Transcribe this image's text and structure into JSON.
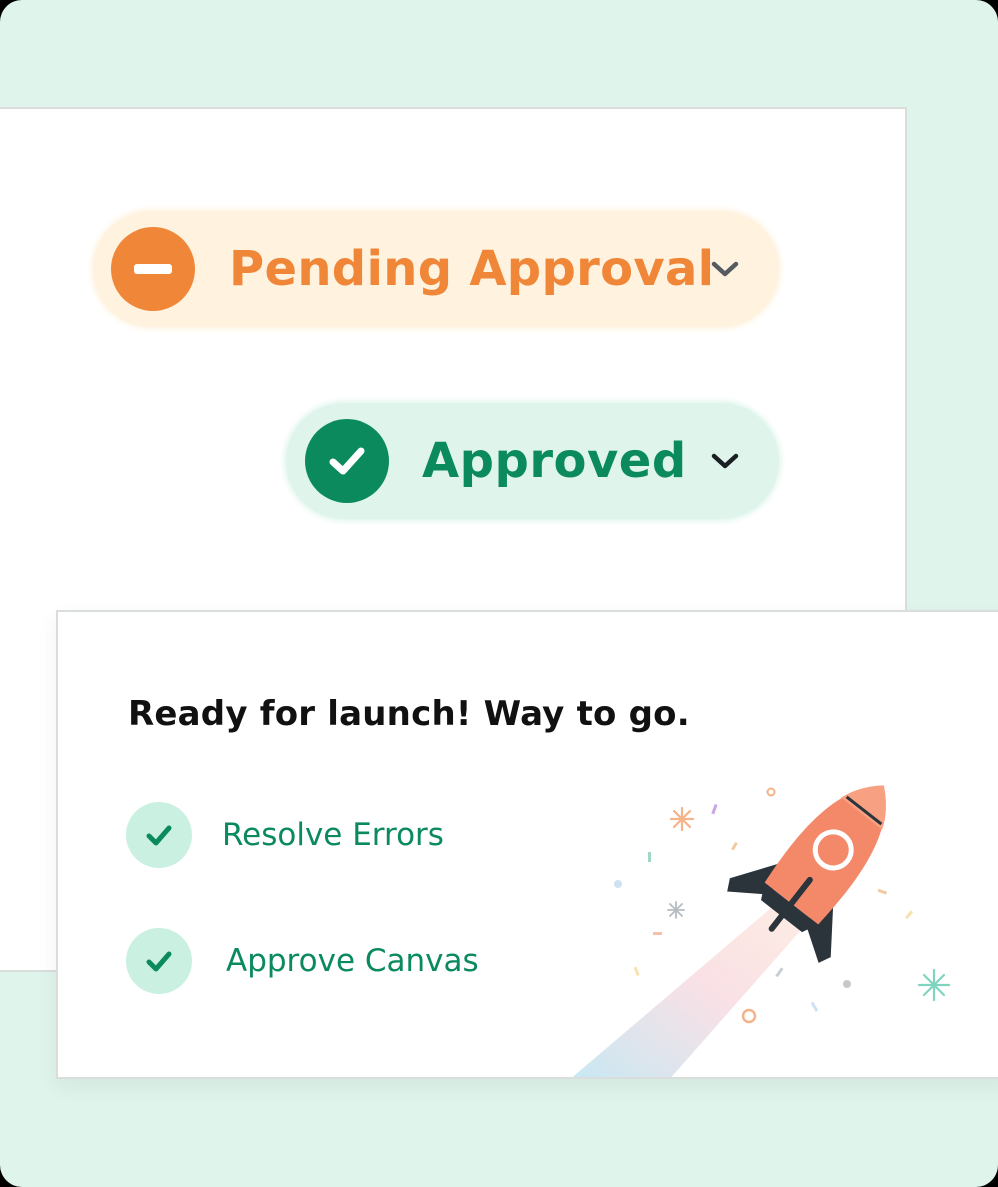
{
  "status_pills": {
    "pending": {
      "label": "Pending Approval",
      "icon": "minus-circle-icon",
      "color": "#f08638",
      "background": "#fff3e0"
    },
    "approved": {
      "label": "Approved",
      "icon": "check-circle-icon",
      "color": "#0b8a5e",
      "background": "#dff5ec"
    }
  },
  "launch_card": {
    "title": "Ready for launch! Way to go.",
    "checklist": [
      {
        "label": "Resolve Errors",
        "icon": "check-icon",
        "done": true
      },
      {
        "label": "Approve Canvas",
        "icon": "check-icon",
        "done": true
      }
    ],
    "illustration": "rocket-icon"
  },
  "colors": {
    "page_background": "#dff5ec",
    "accent_green": "#0b8a5e",
    "accent_orange": "#f08638",
    "rocket_body": "#f4896a",
    "rocket_fins": "#2b333b"
  }
}
